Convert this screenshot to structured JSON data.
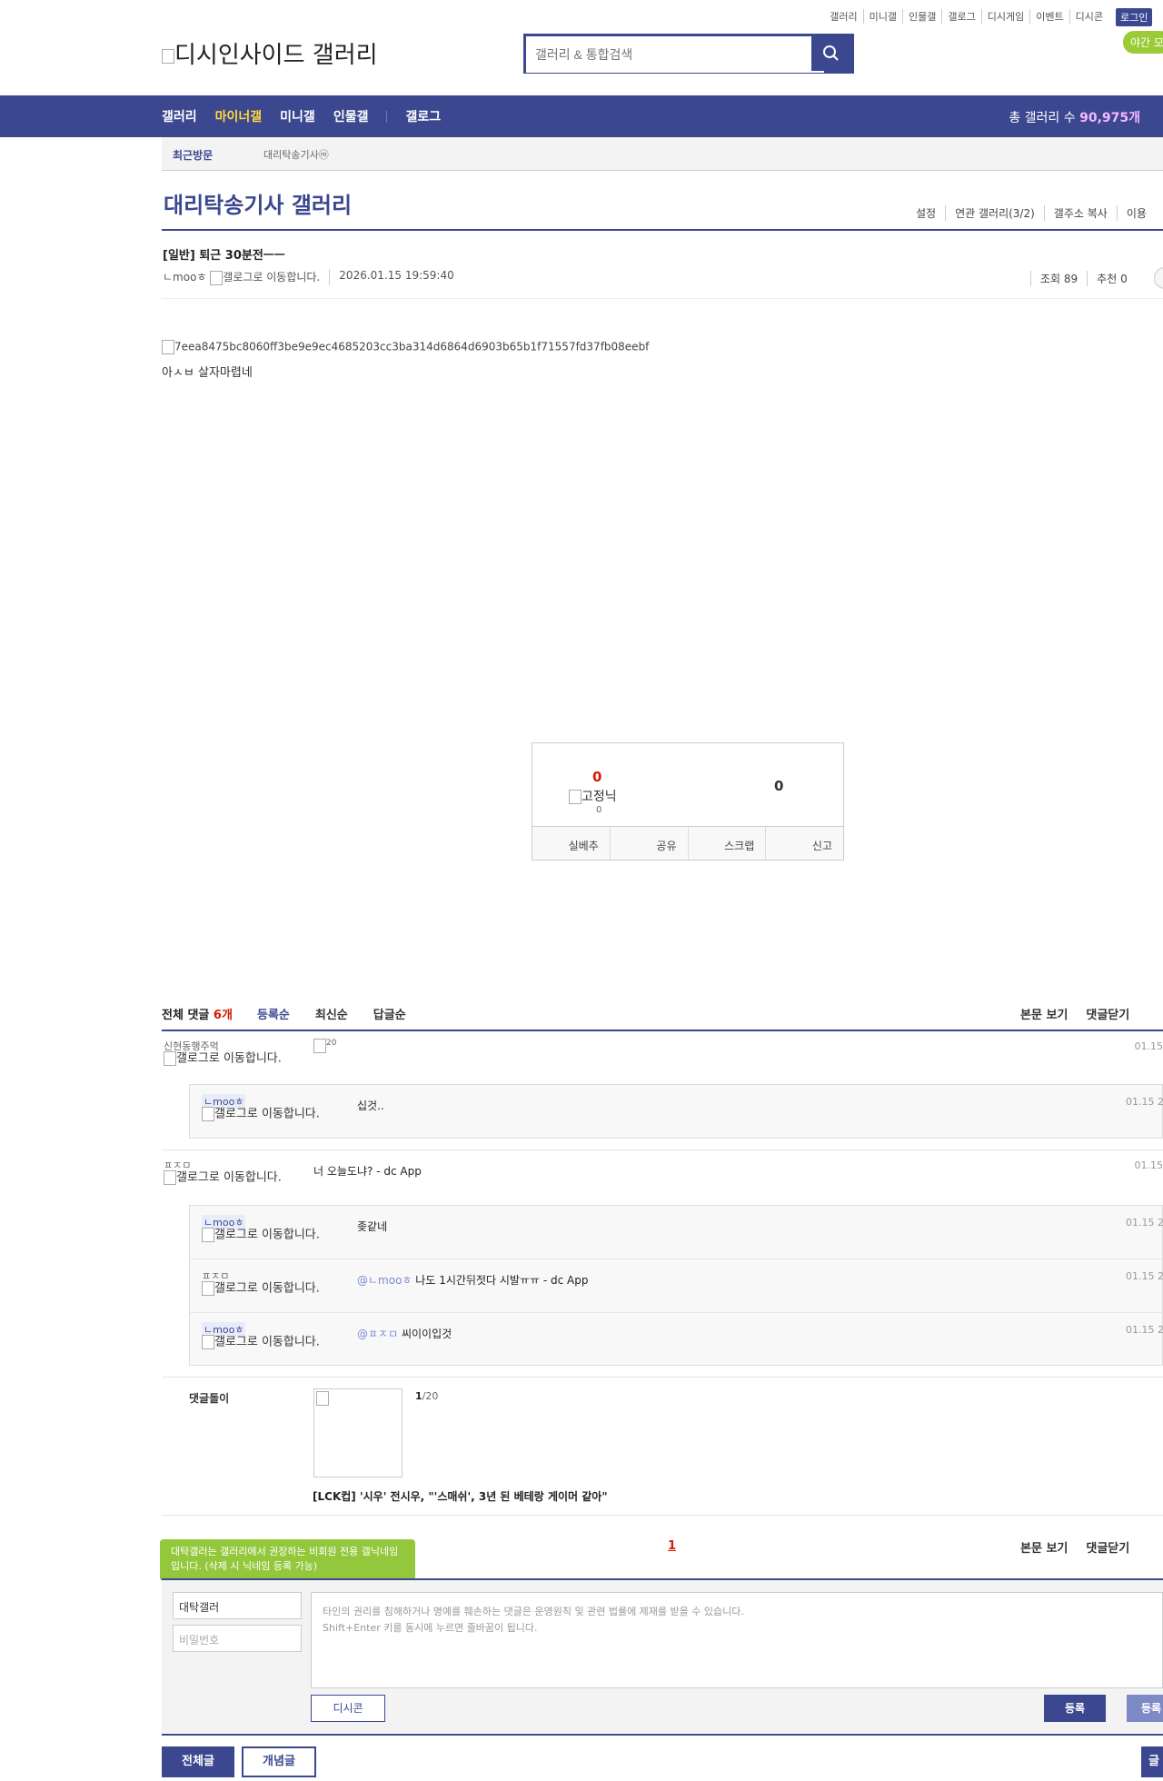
{
  "top_links": [
    "갤러리",
    "미니갤",
    "인물갤",
    "갤로그",
    "디시게임",
    "이벤트",
    "디시콘"
  ],
  "login": "로그인",
  "night_mode": "야간 모",
  "logo": "디시인사이드 갤러리",
  "search": {
    "placeholder": "갤러리 & 통합검색"
  },
  "gnb": {
    "items": [
      "갤러리",
      "마이너갤",
      "미니갤",
      "인물갤",
      "갤로그"
    ],
    "total_label": "총 갤러리 수",
    "total_count": "90,975개"
  },
  "recent": {
    "label": "최근방문",
    "item": "대리탁송기사ⓜ"
  },
  "gallery_title": "대리탁송기사 갤러리",
  "gallery_links": [
    "설정",
    "연관 갤러리(3/2)",
    "갤주소 복사",
    "이용"
  ],
  "post": {
    "title": "[일반] 퇴근 30분전ㅡㅡ",
    "author": "ㄴmooㅎ",
    "gallog_alt": "갤로그로 이동합니다.",
    "date": "2026.01.15 19:59:40",
    "views": "조회 89",
    "recommend": "추천 0",
    "image_alt": "7eea8475bc8060ff3be9e9ec4685203cc3ba314d6864d6903b65b1f71557fd37fb08eebf",
    "body": "아ㅅㅂ 살자마렵네"
  },
  "recommend_box": {
    "up": "0",
    "fixed_alt": "고정닉",
    "fixed_count": "0",
    "down": "0",
    "buttons": [
      "실베추",
      "공유",
      "스크랩",
      "신고"
    ]
  },
  "comments_header": {
    "total_label": "전체 댓글",
    "total_count": "6개",
    "sort": [
      "등록순",
      "최신순",
      "답글순"
    ],
    "view_body": "본문 보기",
    "close_comments": "댓글닫기"
  },
  "comments": [
    {
      "nick": "신현동행주먹",
      "gallog": "갤로그로 이동합니다.",
      "text": "20",
      "time": "01.15"
    },
    {
      "nick": "ㅍㅈㅁ",
      "gallog": "갤로그로 이동합니다.",
      "text": "너 오늘도냐? - dc App",
      "time": "01.15"
    }
  ],
  "replies_1": [
    {
      "nick": "ㄴmooㅎ",
      "gallog": "갤로그로 이동합니다.",
      "text": "십것..",
      "time": "01.15 2"
    }
  ],
  "replies_2": [
    {
      "nick": "ㄴmooㅎ",
      "gallog": "갤로그로 이동합니다.",
      "mention": "",
      "text": "좆같네",
      "time": "01.15 2"
    },
    {
      "nick": "ㅍㅈㅁ",
      "gallog": "갤로그로 이동합니다.",
      "mention": "@ㄴmooㅎ",
      "text": "나도 1시간뒤젓다 시발ㅠㅠ - dc App",
      "time": "01.15 2"
    },
    {
      "nick": "ㄴmooㅎ",
      "gallog": "갤로그로 이동합니다.",
      "mention": "@ㅍㅈㅁ",
      "text": "씨이이입것",
      "time": "01.15 2"
    }
  ],
  "dcboy": {
    "label": "댓글돌이",
    "page_current": "1",
    "page_total": "/20",
    "caption": "[LCK컵] '시우' 전시우, \"'스매쉬', 3년 된 베테랑 게이머 같아\""
  },
  "pagination": {
    "current": "1"
  },
  "tooltip": "대탁갤러는 갤러리에서 권장하는 비회원 전용 갤닉네임입니다. (삭제 시 닉네임 등록 가능)",
  "write": {
    "nick_value": "대탁갤러",
    "pw_placeholder": "비밀번호",
    "notice_1": "타인의 권리를 침해하거나 명예를 훼손하는 댓글은 운영원칙 및 관련 법률에 제재를 받을 수 있습니다.",
    "notice_2": "Shift+Enter 키를 동시에 누르면 줄바꿈이 됩니다.",
    "dccon": "디시콘",
    "submit": "등록",
    "submit2": "등록"
  },
  "bottom": {
    "all": "전체글",
    "concept": "개념글",
    "write": "글쓰기"
  }
}
